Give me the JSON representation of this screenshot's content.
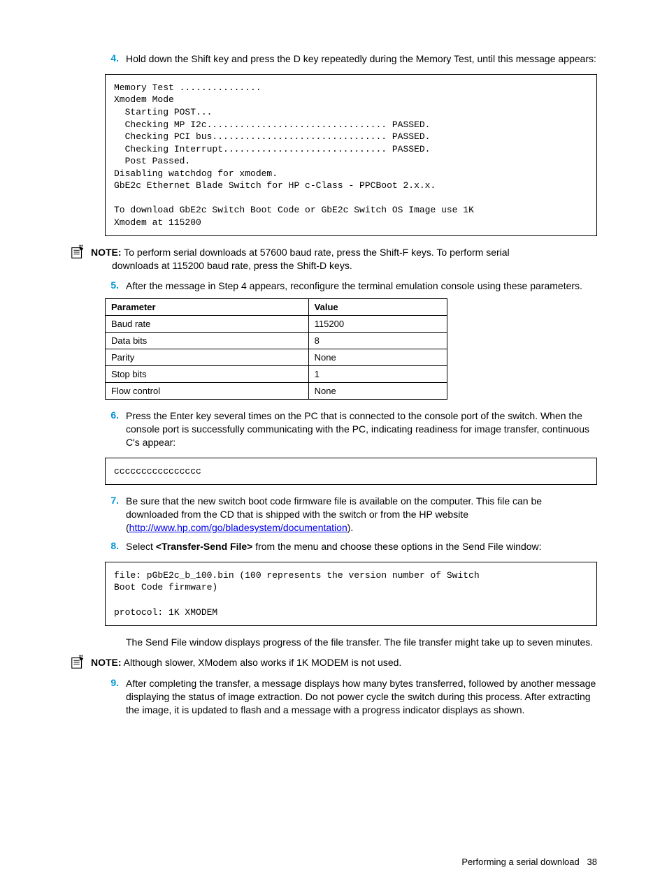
{
  "steps": {
    "s4_num": "4.",
    "s4_text": "Hold down the Shift key and press the D key repeatedly during the Memory Test, until this message appears:",
    "s5_num": "5.",
    "s5_text": "After the message in Step 4 appears, reconfigure the terminal emulation console using these parameters.",
    "s6_num": "6.",
    "s6_text": "Press the Enter key several times on the PC that is connected to the console port of the switch. When the console port is successfully communicating with the PC, indicating readiness for image transfer, continuous C's appear:",
    "s7_num": "7.",
    "s7_text_a": "Be sure that the new switch boot code firmware file is available on the computer. This file can be downloaded from the CD that is shipped with the switch or from the HP website (",
    "s7_link": "http://www.hp.com/go/bladesystem/documentation",
    "s7_text_b": ").",
    "s8_num": "8.",
    "s8_text_a": "Select ",
    "s8_bold": "<Transfer-Send File>",
    "s8_text_b": " from the menu and choose these options in the Send File window:",
    "s8_after": "The Send File window displays progress of the file transfer. The file transfer might take up to seven minutes.",
    "s9_num": "9.",
    "s9_text": "After completing the transfer, a message displays how many bytes transferred, followed by another message displaying the status of image extraction. Do not power cycle the switch during this process. After extracting the image, it is updated to flash and a message with a progress indicator displays as shown."
  },
  "code1": "Memory Test ...............\nXmodem Mode\n  Starting POST...\n  Checking MP I2c................................. PASSED.\n  Checking PCI bus................................ PASSED.\n  Checking Interrupt.............................. PASSED.\n  Post Passed.\nDisabling watchdog for xmodem.\nGbE2c Ethernet Blade Switch for HP c-Class - PPCBoot 2.x.x.\n\nTo download GbE2c Switch Boot Code or GbE2c Switch OS Image use 1K\nXmodem at 115200",
  "code2": "cccccccccccccccc",
  "code3": "file: pGbE2c_b_100.bin (100 represents the version number of Switch\nBoot Code firmware)\n\nprotocol: 1K XMODEM",
  "notes": {
    "n1_label": "NOTE:",
    "n1_text": "  To perform serial downloads at 57600 baud rate, press the Shift-F keys. To perform serial downloads at 115200 baud rate, press the Shift-D keys.",
    "n2_label": "NOTE:",
    "n2_text": "  Although slower, XModem also works if 1K MODEM is not used."
  },
  "table": {
    "h1": "Parameter",
    "h2": "Value",
    "rows": [
      {
        "p": "Baud rate",
        "v": "115200"
      },
      {
        "p": "Data bits",
        "v": "8"
      },
      {
        "p": "Parity",
        "v": "None"
      },
      {
        "p": "Stop bits",
        "v": "1"
      },
      {
        "p": "Flow control",
        "v": "None"
      }
    ]
  },
  "footer": {
    "text": "Performing a serial download",
    "page": "38"
  }
}
